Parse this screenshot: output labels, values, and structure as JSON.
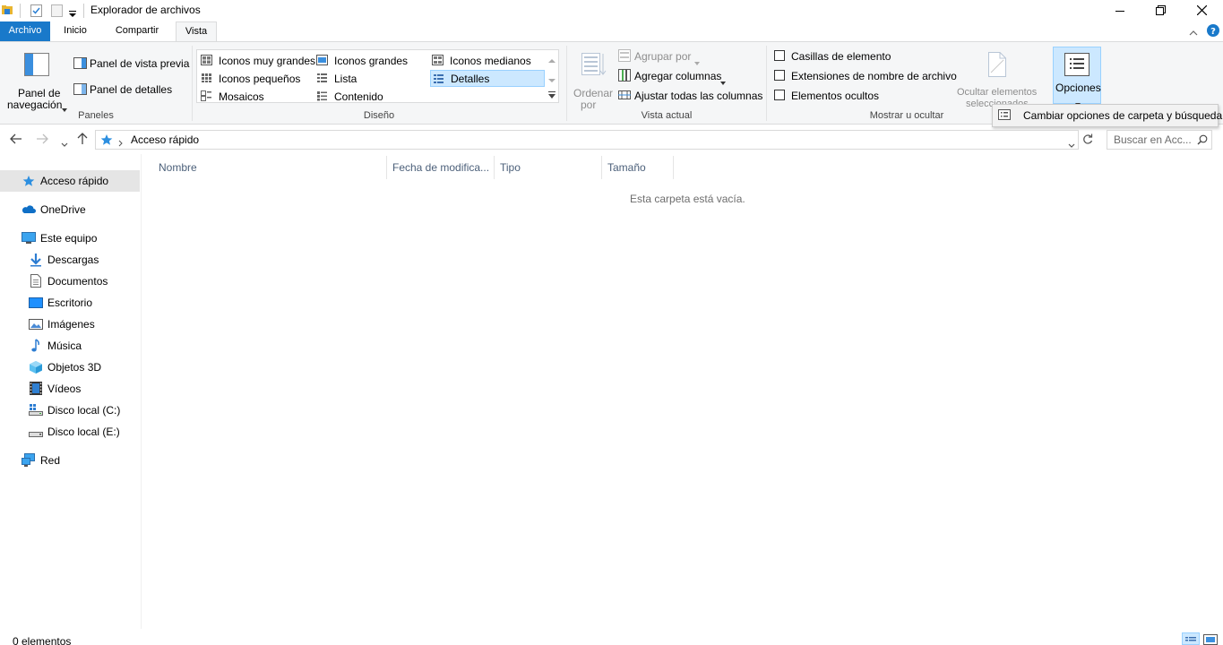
{
  "window": {
    "title": "Explorador de archivos"
  },
  "tabs": {
    "file": "Archivo",
    "home": "Inicio",
    "share": "Compartir",
    "view": "Vista"
  },
  "ribbon": {
    "panes": {
      "nav_pane_line1": "Panel de",
      "nav_pane_line2": "navegación",
      "preview_pane": "Panel de vista previa",
      "details_pane": "Panel de detalles",
      "label": "Paneles"
    },
    "layout": {
      "items": [
        "Iconos muy grandes",
        "Iconos grandes",
        "Iconos medianos",
        "Iconos pequeños",
        "Lista",
        "Detalles",
        "Mosaicos",
        "Contenido"
      ],
      "selected": "Detalles",
      "label": "Diseño"
    },
    "current_view": {
      "sort_line1": "Ordenar",
      "sort_line2": "por",
      "group_by": "Agrupar por",
      "add_columns": "Agregar columnas",
      "fit_columns": "Ajustar todas las columnas",
      "label": "Vista actual"
    },
    "show_hide": {
      "item_checkboxes": "Casillas de elemento",
      "file_extensions": "Extensiones de nombre de archivo",
      "hidden_items": "Elementos ocultos",
      "hide_selected_line1": "Ocultar elementos",
      "hide_selected_line2": "seleccionados",
      "label": "Mostrar u ocultar"
    },
    "options": {
      "label": "Opciones",
      "menu_item": "Cambiar opciones de carpeta y búsqueda"
    }
  },
  "address": {
    "path": "Acceso rápido",
    "search_placeholder": "Buscar en Acc..."
  },
  "nav": {
    "quick_access": "Acceso rápido",
    "onedrive": "OneDrive",
    "this_pc": "Este equipo",
    "downloads": "Descargas",
    "documents": "Documentos",
    "desktop": "Escritorio",
    "pictures": "Imágenes",
    "music": "Música",
    "objects3d": "Objetos 3D",
    "videos": "Vídeos",
    "disk_c": "Disco local (C:)",
    "disk_e": "Disco local (E:)",
    "network": "Red"
  },
  "columns": {
    "name": "Nombre",
    "date": "Fecha de modifica...",
    "type": "Tipo",
    "size": "Tamaño"
  },
  "content": {
    "empty_message": "Esta carpeta está vacía."
  },
  "status": {
    "count": "0 elementos"
  },
  "colors": {
    "accent": "#1979ca",
    "ribbon_bg": "#f5f6f7",
    "selected_bg": "#cce8ff",
    "nav_selected_bg": "#e5e5e5"
  }
}
